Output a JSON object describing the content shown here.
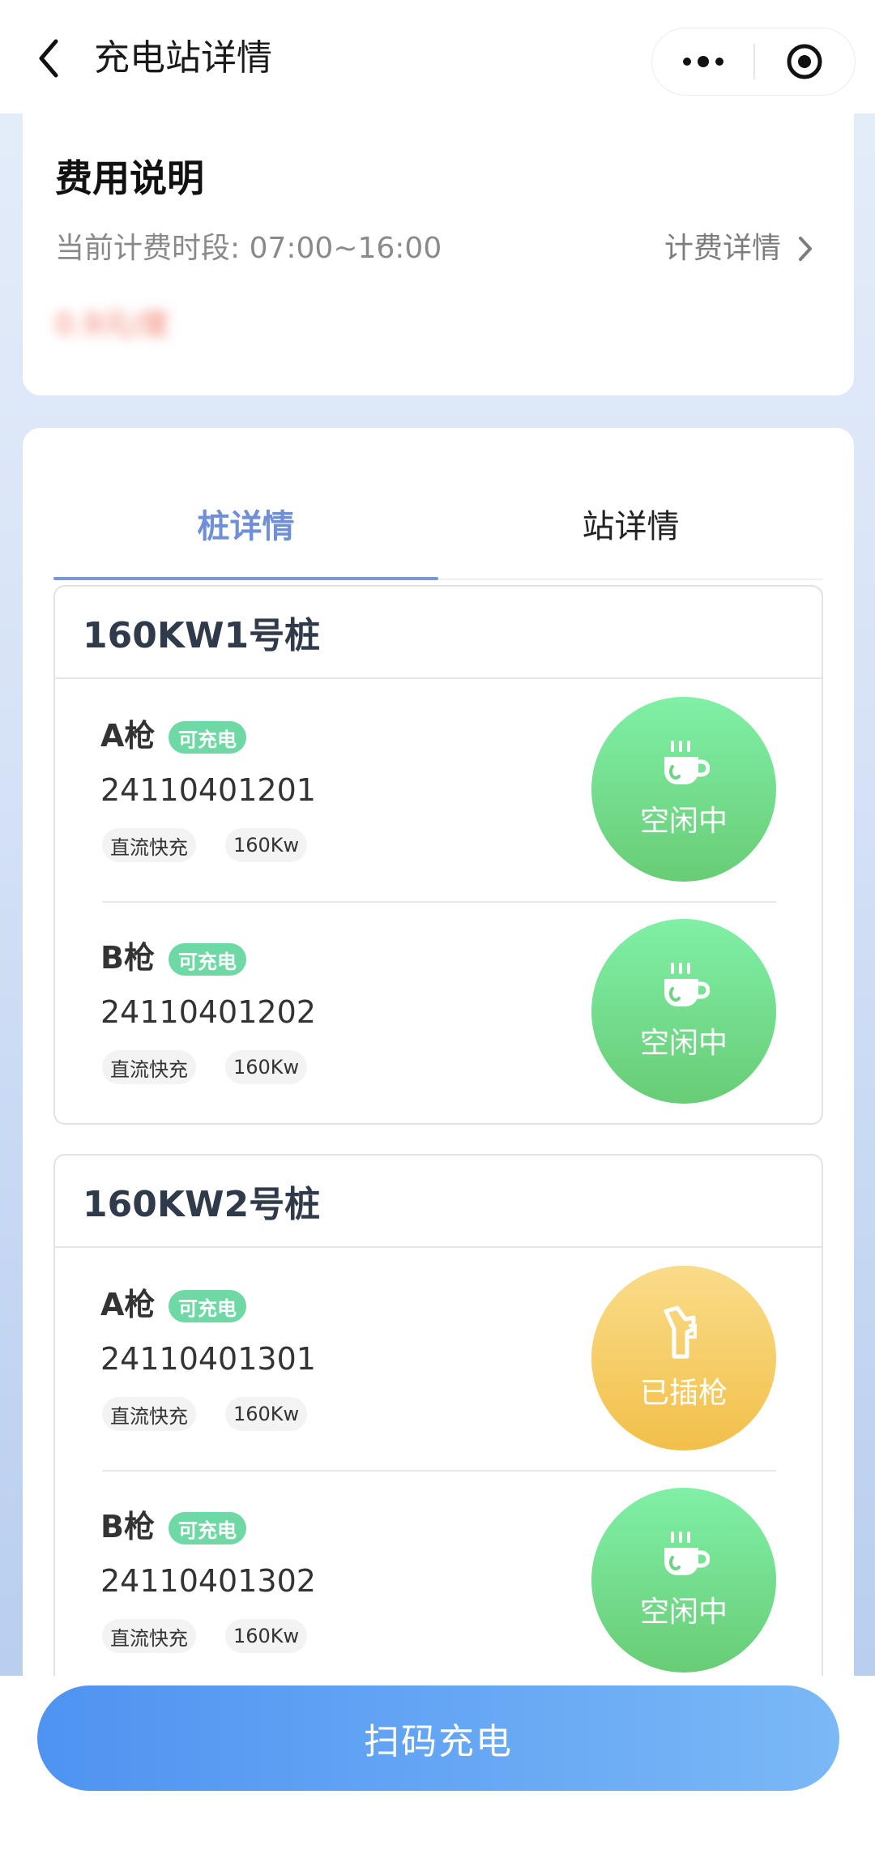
{
  "header": {
    "title": "充电站详情"
  },
  "fee": {
    "title": "费用说明",
    "period": "当前计费时段: 07:00~16:00",
    "detail_link": "计费详情",
    "price": "0.9元/度"
  },
  "tabs": [
    {
      "label": "桩详情",
      "active": true
    },
    {
      "label": "站详情",
      "active": false
    }
  ],
  "piles": [
    {
      "title": "160KW1号桩",
      "guns": [
        {
          "name": "A枪",
          "badge": "可充电",
          "code": "24110401201",
          "tag1": "直流快充",
          "tag2": "160Kw",
          "status": "空闲中",
          "status_type": "idle"
        },
        {
          "name": "B枪",
          "badge": "可充电",
          "code": "24110401202",
          "tag1": "直流快充",
          "tag2": "160Kw",
          "status": "空闲中",
          "status_type": "idle"
        }
      ]
    },
    {
      "title": "160KW2号桩",
      "guns": [
        {
          "name": "A枪",
          "badge": "可充电",
          "code": "24110401301",
          "tag1": "直流快充",
          "tag2": "160Kw",
          "status": "已插枪",
          "status_type": "plugged"
        },
        {
          "name": "B枪",
          "badge": "可充电",
          "code": "24110401302",
          "tag1": "直流快充",
          "tag2": "160Kw",
          "status": "空闲中",
          "status_type": "idle"
        }
      ]
    }
  ],
  "bottom": {
    "scan_button": "扫码充电"
  },
  "colors": {
    "accent_blue": "#6f8fd6",
    "badge_green": "#6ed9a4",
    "idle_green": "#69cc76",
    "plugged_yellow": "#f2c04a",
    "button_blue": "#4f93f2"
  }
}
